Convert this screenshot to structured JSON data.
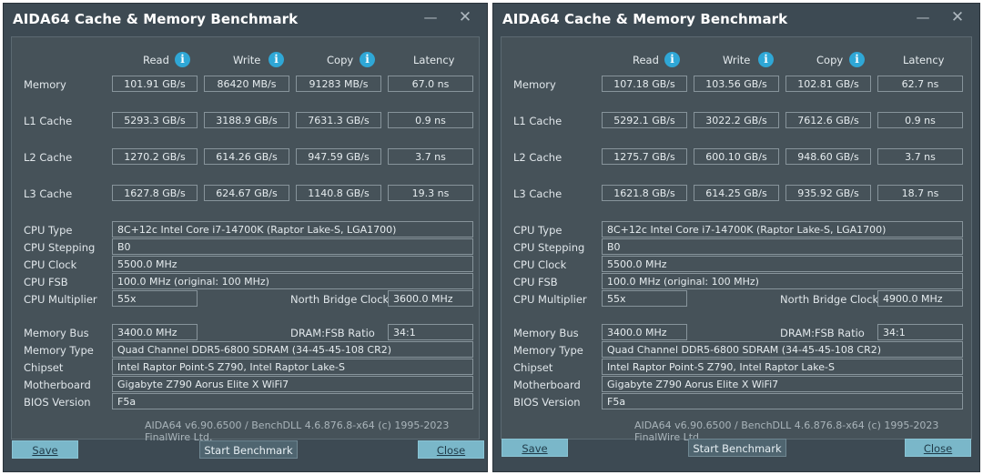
{
  "windows": [
    {
      "title": "AIDA64 Cache & Memory Benchmark",
      "columns": [
        "Read",
        "Write",
        "Copy",
        "Latency"
      ],
      "rows": [
        {
          "label": "Memory",
          "values": [
            "101.91 GB/s",
            "86420 MB/s",
            "91283 MB/s",
            "67.0 ns"
          ]
        },
        {
          "label": "L1 Cache",
          "values": [
            "5293.3 GB/s",
            "3188.9 GB/s",
            "7631.3 GB/s",
            "0.9 ns"
          ]
        },
        {
          "label": "L2 Cache",
          "values": [
            "1270.2 GB/s",
            "614.26 GB/s",
            "947.59 GB/s",
            "3.7 ns"
          ]
        },
        {
          "label": "L3 Cache",
          "values": [
            "1627.8 GB/s",
            "624.67 GB/s",
            "1140.8 GB/s",
            "19.3 ns"
          ]
        }
      ],
      "cpu": {
        "type_label": "CPU Type",
        "type": "8C+12c Intel Core i7-14700K  (Raptor Lake-S, LGA1700)",
        "stepping_label": "CPU Stepping",
        "stepping": "B0",
        "clock_label": "CPU Clock",
        "clock": "5500.0 MHz",
        "fsb_label": "CPU FSB",
        "fsb": "100.0 MHz  (original: 100 MHz)",
        "multiplier_label": "CPU Multiplier",
        "multiplier": "55x",
        "nb_clock_label": "North Bridge Clock",
        "nb_clock": "3600.0 MHz"
      },
      "memory": {
        "bus_label": "Memory Bus",
        "bus": "3400.0 MHz",
        "ratio_label": "DRAM:FSB Ratio",
        "ratio": "34:1",
        "type_label": "Memory Type",
        "type": "Quad Channel DDR5-6800 SDRAM  (34-45-45-108 CR2)",
        "chipset_label": "Chipset",
        "chipset": "Intel Raptor Point-S Z790, Intel Raptor Lake-S",
        "motherboard_label": "Motherboard",
        "motherboard": "Gigabyte Z790 Aorus Elite X WiFi7",
        "bios_label": "BIOS Version",
        "bios": "F5a"
      },
      "footer": "AIDA64 v6.90.6500 / BenchDLL 4.6.876.8-x64  (c) 1995-2023 FinalWire Ltd.",
      "buttons": {
        "save": "Save",
        "start": "Start Benchmark",
        "close": "Close"
      }
    },
    {
      "title": "AIDA64 Cache & Memory Benchmark",
      "columns": [
        "Read",
        "Write",
        "Copy",
        "Latency"
      ],
      "rows": [
        {
          "label": "Memory",
          "values": [
            "107.18 GB/s",
            "103.56 GB/s",
            "102.81 GB/s",
            "62.7 ns"
          ]
        },
        {
          "label": "L1 Cache",
          "values": [
            "5292.1 GB/s",
            "3022.2 GB/s",
            "7612.6 GB/s",
            "0.9 ns"
          ]
        },
        {
          "label": "L2 Cache",
          "values": [
            "1275.7 GB/s",
            "600.10 GB/s",
            "948.60 GB/s",
            "3.7 ns"
          ]
        },
        {
          "label": "L3 Cache",
          "values": [
            "1621.8 GB/s",
            "614.25 GB/s",
            "935.92 GB/s",
            "18.7 ns"
          ]
        }
      ],
      "cpu": {
        "type_label": "CPU Type",
        "type": "8C+12c Intel Core i7-14700K  (Raptor Lake-S, LGA1700)",
        "stepping_label": "CPU Stepping",
        "stepping": "B0",
        "clock_label": "CPU Clock",
        "clock": "5500.0 MHz",
        "fsb_label": "CPU FSB",
        "fsb": "100.0 MHz  (original: 100 MHz)",
        "multiplier_label": "CPU Multiplier",
        "multiplier": "55x",
        "nb_clock_label": "North Bridge Clock",
        "nb_clock": "4900.0 MHz"
      },
      "memory": {
        "bus_label": "Memory Bus",
        "bus": "3400.0 MHz",
        "ratio_label": "DRAM:FSB Ratio",
        "ratio": "34:1",
        "type_label": "Memory Type",
        "type": "Quad Channel DDR5-6800 SDRAM  (34-45-45-108 CR2)",
        "chipset_label": "Chipset",
        "chipset": "Intel Raptor Point-S Z790, Intel Raptor Lake-S",
        "motherboard_label": "Motherboard",
        "motherboard": "Gigabyte Z790 Aorus Elite X WiFi7",
        "bios_label": "BIOS Version",
        "bios": "F5a"
      },
      "footer": "AIDA64 v6.90.6500 / BenchDLL 4.6.876.8-x64  (c) 1995-2023 FinalWire Ltd.",
      "buttons": {
        "save": "Save",
        "start": "Start Benchmark",
        "close": "Close"
      }
    }
  ],
  "icons": {
    "info": "info-icon",
    "minimize": "minimize-icon",
    "close": "close-icon"
  },
  "colors": {
    "window_bg": "#3d4a53",
    "panel_bg": "#465259",
    "accent_button": "#7ab7c9",
    "info_icon": "#2fa7d6"
  }
}
